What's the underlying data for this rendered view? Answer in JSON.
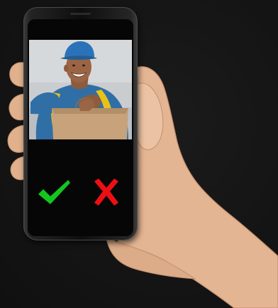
{
  "call_screen": {
    "accept_action": "accept",
    "decline_action": "decline"
  },
  "icons": {
    "accept": "checkmark-icon",
    "decline": "x-mark-icon"
  },
  "colors": {
    "background": "#151515",
    "accept": "#13c61f",
    "decline": "#ee0f14",
    "shirt": "#2f6fa6",
    "cap": "#2b73b8",
    "backpack_strap": "#e6c21a",
    "package": "#c7a27a"
  }
}
